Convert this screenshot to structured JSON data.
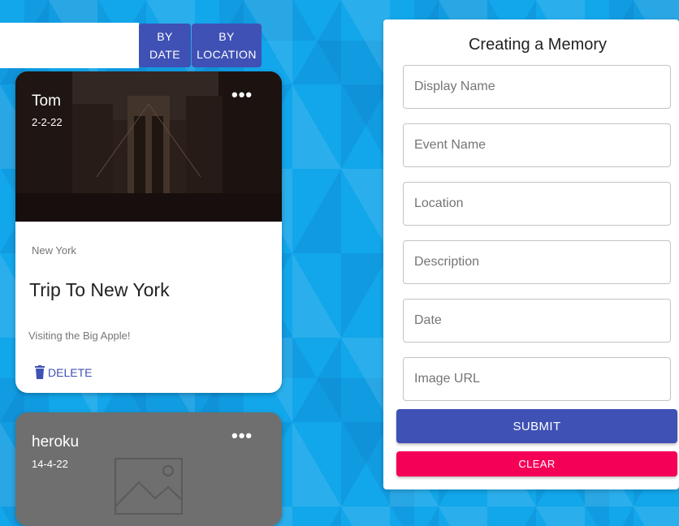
{
  "toolbar": {
    "search_placeholder": "",
    "sort_date_label": "BY\nDATE",
    "sort_location_label": "BY\nLOCATION"
  },
  "posts": [
    {
      "author": "Tom",
      "date": "2-2-22",
      "more_label": "•••",
      "location": "New York",
      "title": "Trip To New York",
      "message": "Visiting the Big Apple!",
      "delete_label": "DELETE",
      "delete_icon": "trash-icon"
    },
    {
      "author": "heroku",
      "date": "14-4-22",
      "more_label": "•••",
      "image_icon": "image-placeholder-icon"
    }
  ],
  "form": {
    "title": "Creating a Memory",
    "fields": [
      {
        "placeholder": "Display Name",
        "value": ""
      },
      {
        "placeholder": "Event Name",
        "value": ""
      },
      {
        "placeholder": "Location",
        "value": ""
      },
      {
        "placeholder": "Description",
        "value": ""
      },
      {
        "placeholder": "Date",
        "value": ""
      },
      {
        "placeholder": "Image URL",
        "value": ""
      }
    ],
    "submit_label": "SUBMIT",
    "clear_label": "CLEAR"
  },
  "colors": {
    "primary": "#3f51b5",
    "secondary": "#f50057",
    "background": "#12a6ea"
  }
}
